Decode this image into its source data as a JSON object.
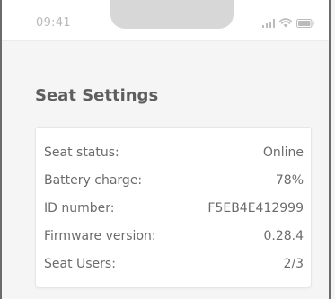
{
  "status_bar": {
    "time": "09:41",
    "icons": [
      "signal-icon",
      "wifi-icon",
      "battery-icon"
    ]
  },
  "page": {
    "title": "Seat Settings"
  },
  "seat_info": {
    "rows": [
      {
        "label": "Seat status:",
        "value": "Online"
      },
      {
        "label": "Battery charge:",
        "value": "78%"
      },
      {
        "label": "ID number:",
        "value": "F5EB4E412999"
      },
      {
        "label": "Firmware version:",
        "value": "0.28.4"
      },
      {
        "label": "Seat Users:",
        "value": "2/3"
      }
    ]
  },
  "colors": {
    "title": "#5e5e5e",
    "text": "#6b6b6b",
    "status_gray": "#bbbbbb",
    "background": "#f5f5f5",
    "card": "#ffffff"
  }
}
